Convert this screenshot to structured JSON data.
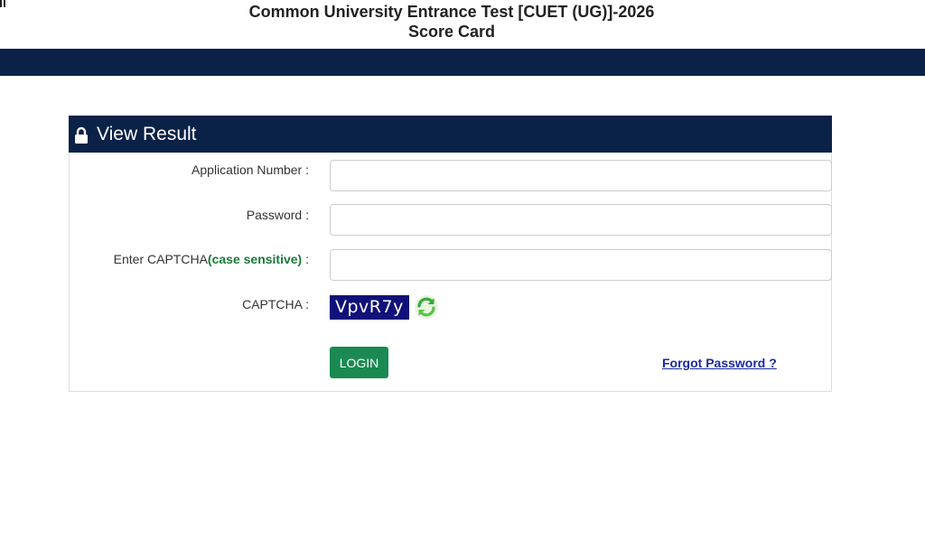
{
  "header": {
    "title_line1": "Common University Entrance Test [CUET (UG)]-2026",
    "title_line2": "Score Card"
  },
  "panel": {
    "title": "View Result",
    "icon": "lock-icon"
  },
  "form": {
    "application_number_label": "Application Number :",
    "application_number_value": "",
    "password_label": "Password :",
    "password_value": "",
    "captcha_input_label": "Enter CAPTCHA",
    "captcha_input_note": "(case sensitive)",
    "captcha_input_suffix": " :",
    "captcha_input_value": "",
    "captcha_label": "CAPTCHA :",
    "captcha_text": "VpvR7y",
    "refresh_icon": "refresh-icon",
    "login_label": "LOGIN",
    "forgot_label": "Forgot Password ?"
  },
  "colors": {
    "navy": "#0a2248",
    "login_green": "#1a8a52",
    "note_green": "#1a7a3c",
    "captcha_bg": "#11117a",
    "link_blue": "#1a2aa0"
  }
}
